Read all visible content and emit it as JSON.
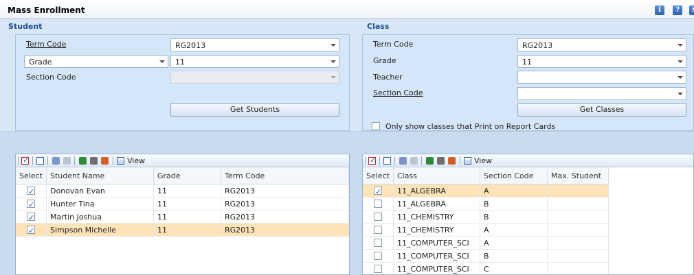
{
  "window": {
    "title": "Mass Enrollment",
    "icons": [
      "info-icon",
      "help-icon",
      "close-icon"
    ]
  },
  "student": {
    "section_title": "Student",
    "term_code_label": "Term Code",
    "term_code_value": "RG2013",
    "grade_selector": "Grade",
    "grade_value": "11",
    "section_code_label": "Section Code",
    "section_code_value": "",
    "get_button": "Get Students"
  },
  "class": {
    "section_title": "Class",
    "term_code_label": "Term Code",
    "term_code_value": "RG2013",
    "grade_label": "Grade",
    "grade_value": "11",
    "teacher_label": "Teacher",
    "teacher_value": "",
    "section_code_label": "Section Code",
    "section_code_value": "",
    "get_button": "Get Classes",
    "print_option_label": "Only show classes that Print on Report Cards",
    "print_option_checked": false
  },
  "student_grid": {
    "view_label": "View",
    "columns": [
      "Select",
      "Student Name",
      "Grade",
      "Term Code"
    ],
    "rows": [
      {
        "checked": true,
        "name": "Donovan  Evan",
        "grade": "11",
        "term": "RG2013"
      },
      {
        "checked": true,
        "name": "Hunter  Tina",
        "grade": "11",
        "term": "RG2013"
      },
      {
        "checked": true,
        "name": "Martin  Joshua",
        "grade": "11",
        "term": "RG2013"
      },
      {
        "checked": true,
        "name": "Simpson  Michelle",
        "grade": "11",
        "term": "RG2013",
        "selected": true
      }
    ]
  },
  "class_grid": {
    "view_label": "View",
    "columns": [
      "Select",
      "Class",
      "Section Code",
      "Max. Student"
    ],
    "rows": [
      {
        "checked": true,
        "class": "11_ALGEBRA",
        "section": "A",
        "max": "",
        "selected": true
      },
      {
        "checked": false,
        "class": "11_ALGEBRA",
        "section": "B",
        "max": ""
      },
      {
        "checked": false,
        "class": "11_CHEMISTRY",
        "section": "B",
        "max": ""
      },
      {
        "checked": false,
        "class": "11_CHEMISTRY",
        "section": "A",
        "max": ""
      },
      {
        "checked": false,
        "class": "11_COMPUTER_SCI",
        "section": "A",
        "max": ""
      },
      {
        "checked": false,
        "class": "11_COMPUTER_SCI",
        "section": "B",
        "max": ""
      },
      {
        "checked": false,
        "class": "11_COMPUTER_SCI",
        "section": "C",
        "max": ""
      }
    ]
  },
  "colors": {
    "accent": "#1d4b8f",
    "selected_row": "#fde3b8",
    "panel": "#d4e6f7"
  }
}
